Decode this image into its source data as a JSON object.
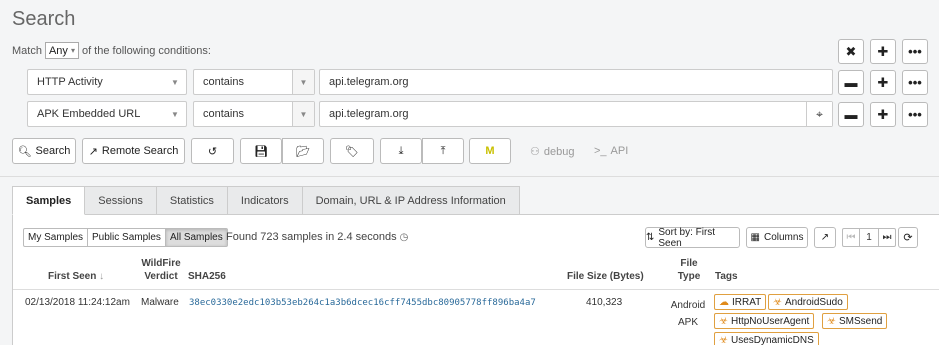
{
  "page_title": "Search",
  "match": {
    "prefix": "Match",
    "value": "Any",
    "suffix": "of the following conditions:"
  },
  "conditions": [
    {
      "field": "HTTP Activity",
      "operator": "contains",
      "value": "api.telegram.org"
    },
    {
      "field": "APK Embedded URL",
      "operator": "contains",
      "value": "api.telegram.org"
    }
  ],
  "toolbar": {
    "search_label": "Search",
    "remote_search_label": "Remote Search",
    "debug_label": "debug",
    "api_label": "API"
  },
  "tabs": [
    "Samples",
    "Sessions",
    "Statistics",
    "Indicators",
    "Domain, URL & IP Address Information"
  ],
  "filters": [
    "My Samples",
    "Public Samples",
    "All Samples"
  ],
  "found_text": "Found 723 samples in 2.4 seconds",
  "sort_label": "Sort by: First Seen",
  "columns_label": "Columns",
  "page_number": "1",
  "table": {
    "headers": {
      "first_seen": "First Seen",
      "verdict_line1": "WildFire",
      "verdict_line2": "Verdict",
      "sha256": "SHA256",
      "file_size": "File Size (Bytes)",
      "file_type_line1": "File",
      "file_type_line2": "Type",
      "tags": "Tags"
    },
    "rows": [
      {
        "first_seen": "02/13/2018 11:24:12am",
        "verdict": "Malware",
        "sha256": "38ec0330e2edc103b53eb264c1a3b6dcec16cff7455dbc80905778ff896ba4a7",
        "file_size": "410,323",
        "file_type_line1": "Android",
        "file_type_line2": "APK",
        "tags": [
          "IRRAT",
          "AndroidSudo",
          "HttpNoUserAgent",
          "SMSsend",
          "UsesDynamicDNS"
        ]
      }
    ]
  }
}
